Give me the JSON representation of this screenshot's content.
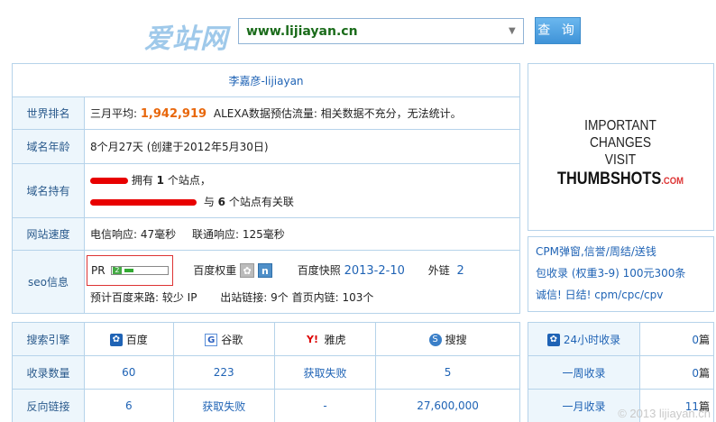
{
  "header": {
    "logo": "爱站网",
    "search_value": "www.lijiayan.cn",
    "query_label": "查 询"
  },
  "site_title": "李嘉彦-lijiayan",
  "rows": {
    "world_rank": {
      "label": "世界排名",
      "prefix": "三月平均:",
      "rank": "1,942,919",
      "alexa": "ALEXA数据预估流量: 相关数据不充分，无法统计。"
    },
    "domain_age": {
      "label": "域名年龄",
      "text": "8个月27天 (创建于2012年5月30日)"
    },
    "domain_owner": {
      "label": "域名持有",
      "line1_mid": "拥有",
      "line1_count": "1",
      "line1_suffix": "个站点，",
      "line2_mid": "与",
      "line2_count": "6",
      "line2_suffix": "个站点有关联"
    },
    "speed": {
      "label": "网站速度",
      "telecom": "电信响应: 47毫秒",
      "unicom": "联通响应: 125毫秒"
    },
    "seo": {
      "label": "seo信息",
      "pr_label": "PR",
      "pr_value": "2",
      "baidu_weight_label": "百度权重",
      "baidu_weight_value": "n",
      "snapshot_label": "百度快照",
      "snapshot_date": "2013-2-10",
      "outlink_label": "外链",
      "outlink_value": "2",
      "line2_baidu_traffic": "预计百度来路: 较少 IP",
      "line2_outlinks": "出站链接: 9个 首页内链: 103个"
    }
  },
  "ad": {
    "line1": "IMPORTANT CHANGES",
    "line2": "VISIT",
    "brand": "THUMBSHOTS",
    "brand_suffix": ".COM",
    "promo1": "CPM弹窗,信誉/周结/送钱",
    "promo2": "包收录 (权重3-9) 100元300条",
    "promo3": "诚信! 日结! cpm/cpc/cpv"
  },
  "stats": {
    "header_label": "搜索引擎",
    "engines": [
      {
        "name": "百度",
        "icon": "baidu-paw-icon"
      },
      {
        "name": "谷歌",
        "icon": "google-icon"
      },
      {
        "name": "雅虎",
        "icon": "yahoo-icon"
      },
      {
        "name": "搜搜",
        "icon": "soso-icon"
      }
    ],
    "indexed_label": "收录数量",
    "indexed": [
      "60",
      "223",
      "获取失败",
      "5"
    ],
    "backlinks_label": "反向链接",
    "backlinks": [
      "6",
      "获取失败",
      "-",
      "27,600,000"
    ]
  },
  "side": {
    "rows": [
      {
        "label": "24小时收录",
        "value": "0",
        "unit": "篇"
      },
      {
        "label": "一周收录",
        "value": "0",
        "unit": "篇"
      },
      {
        "label": "一月收录",
        "value": "11",
        "unit": "篇"
      }
    ]
  },
  "watermark": "© 2013 lijiayan.cn",
  "colors": {
    "accent_blue": "#1f63b5",
    "rank_orange": "#e8670c",
    "border": "#b6d3ea",
    "label_bg": "#edf6fc"
  }
}
